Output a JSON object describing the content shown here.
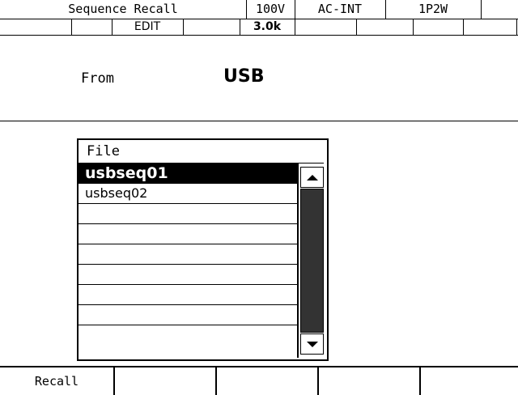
{
  "header": {
    "title": "Sequence Recall",
    "voltage": "100V",
    "source_mode": "AC-INT",
    "wiring": "1P2W"
  },
  "status_row": {
    "edit_label": "EDIT",
    "freq_range": "3.0k"
  },
  "source": {
    "label": "From",
    "value": "USB"
  },
  "file_list": {
    "header": "File",
    "items": [
      "usbseq01",
      "usbseq02",
      "",
      "",
      "",
      "",
      "",
      ""
    ],
    "selected_index": 0
  },
  "softkeys": [
    "Recall",
    "",
    "",
    "",
    ""
  ]
}
